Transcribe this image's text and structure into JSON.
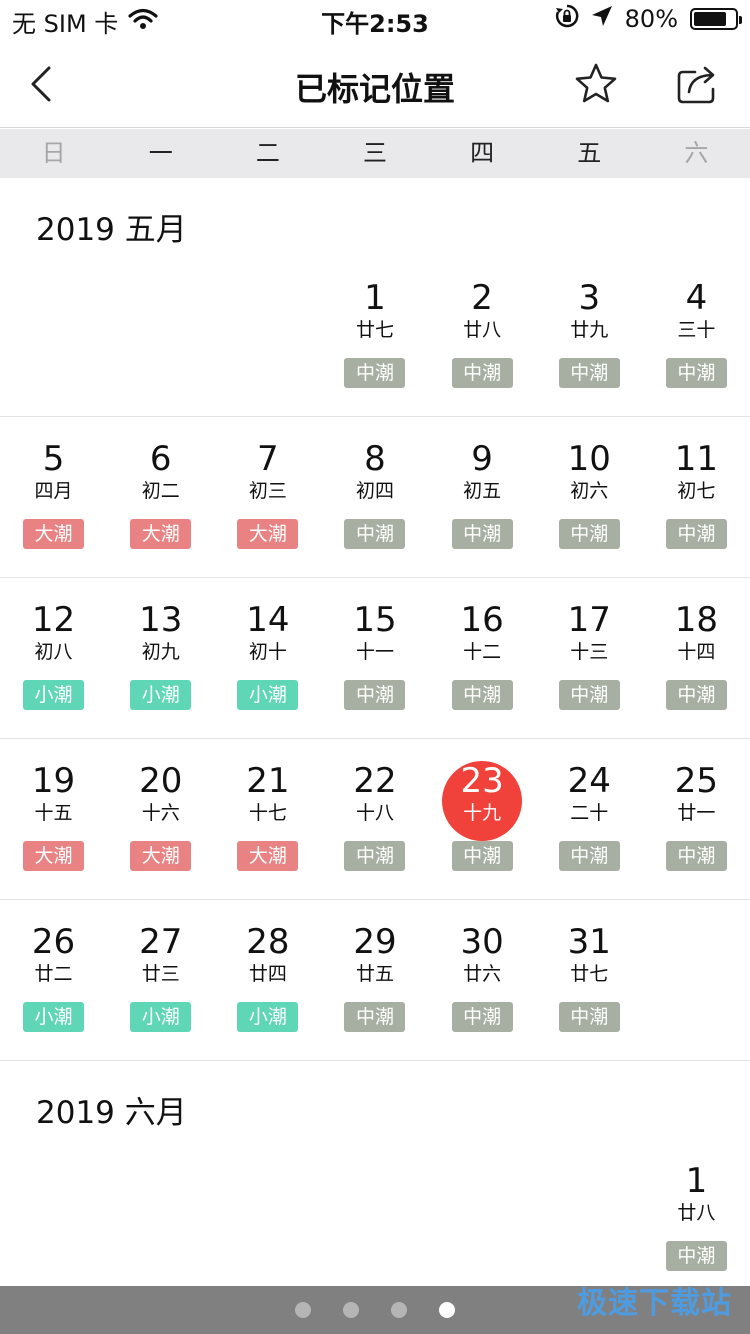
{
  "status_bar": {
    "carrier": "无 SIM 卡",
    "time": "下午2:53",
    "battery": "80%",
    "battery_level": 0.8
  },
  "nav": {
    "title": "已标记位置",
    "back_icon": "chevron-left-icon",
    "favorite_icon": "star-icon",
    "share_icon": "share-icon"
  },
  "weekdays": [
    "日",
    "一",
    "二",
    "三",
    "四",
    "五",
    "六"
  ],
  "tide_colors": {
    "大潮": "#e98383",
    "中潮": "#a7afa2",
    "小潮": "#5fd7b6"
  },
  "months": [
    {
      "label": "2019 五月",
      "weeks": [
        [
          null,
          null,
          null,
          {
            "day": "1",
            "lunar": "廿七",
            "tide": "中潮"
          },
          {
            "day": "2",
            "lunar": "廿八",
            "tide": "中潮"
          },
          {
            "day": "3",
            "lunar": "廿九",
            "tide": "中潮"
          },
          {
            "day": "4",
            "lunar": "三十",
            "tide": "中潮"
          }
        ],
        [
          {
            "day": "5",
            "lunar": "四月",
            "tide": "大潮"
          },
          {
            "day": "6",
            "lunar": "初二",
            "tide": "大潮"
          },
          {
            "day": "7",
            "lunar": "初三",
            "tide": "大潮"
          },
          {
            "day": "8",
            "lunar": "初四",
            "tide": "中潮"
          },
          {
            "day": "9",
            "lunar": "初五",
            "tide": "中潮"
          },
          {
            "day": "10",
            "lunar": "初六",
            "tide": "中潮"
          },
          {
            "day": "11",
            "lunar": "初七",
            "tide": "中潮"
          }
        ],
        [
          {
            "day": "12",
            "lunar": "初八",
            "tide": "小潮"
          },
          {
            "day": "13",
            "lunar": "初九",
            "tide": "小潮"
          },
          {
            "day": "14",
            "lunar": "初十",
            "tide": "小潮"
          },
          {
            "day": "15",
            "lunar": "十一",
            "tide": "中潮"
          },
          {
            "day": "16",
            "lunar": "十二",
            "tide": "中潮"
          },
          {
            "day": "17",
            "lunar": "十三",
            "tide": "中潮"
          },
          {
            "day": "18",
            "lunar": "十四",
            "tide": "中潮"
          }
        ],
        [
          {
            "day": "19",
            "lunar": "十五",
            "tide": "大潮"
          },
          {
            "day": "20",
            "lunar": "十六",
            "tide": "大潮"
          },
          {
            "day": "21",
            "lunar": "十七",
            "tide": "大潮"
          },
          {
            "day": "22",
            "lunar": "十八",
            "tide": "中潮"
          },
          {
            "day": "23",
            "lunar": "十九",
            "tide": "中潮",
            "today": true
          },
          {
            "day": "24",
            "lunar": "二十",
            "tide": "中潮"
          },
          {
            "day": "25",
            "lunar": "廿一",
            "tide": "中潮"
          }
        ],
        [
          {
            "day": "26",
            "lunar": "廿二",
            "tide": "小潮"
          },
          {
            "day": "27",
            "lunar": "廿三",
            "tide": "小潮"
          },
          {
            "day": "28",
            "lunar": "廿四",
            "tide": "小潮"
          },
          {
            "day": "29",
            "lunar": "廿五",
            "tide": "中潮"
          },
          {
            "day": "30",
            "lunar": "廿六",
            "tide": "中潮"
          },
          {
            "day": "31",
            "lunar": "廿七",
            "tide": "中潮"
          },
          null
        ]
      ]
    },
    {
      "label": "2019 六月",
      "weeks": [
        [
          null,
          null,
          null,
          null,
          null,
          null,
          {
            "day": "1",
            "lunar": "廿八",
            "tide": "中潮"
          }
        ]
      ]
    }
  ],
  "page_indicator": {
    "count": 4,
    "active": 3
  },
  "watermark": "极速下载站"
}
